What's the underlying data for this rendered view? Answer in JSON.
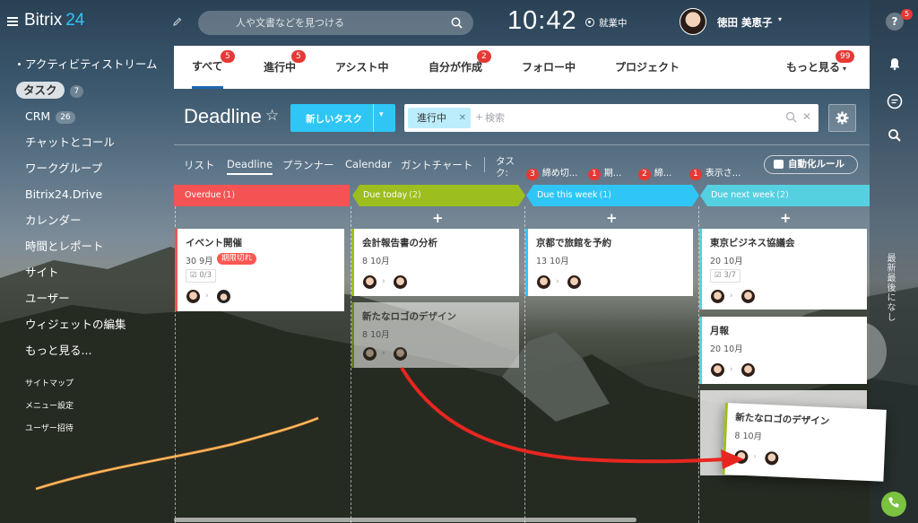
{
  "app": {
    "brand": "Bitrix",
    "brand_version": "24"
  },
  "left_menu": {
    "items": [
      {
        "label": "アクティビティストリーム",
        "counter": ""
      },
      {
        "label": "タスク",
        "counter": "7",
        "active": true
      },
      {
        "label": "CRM",
        "counter": "26"
      },
      {
        "label": "チャットとコール",
        "counter": ""
      },
      {
        "label": "ワークグループ",
        "counter": ""
      },
      {
        "label": "Bitrix24.Drive",
        "counter": ""
      },
      {
        "label": "カレンダー",
        "counter": ""
      },
      {
        "label": "時間とレポート",
        "counter": ""
      },
      {
        "label": "サイト",
        "counter": ""
      },
      {
        "label": "ユーザー",
        "counter": ""
      },
      {
        "label": "ウィジェットの編集",
        "counter": ""
      },
      {
        "label": "もっと見る...",
        "counter": ""
      }
    ],
    "sitemap": "サイトマップ",
    "menu_settings": "メニュー設定",
    "invite_users": "ユーザー招待"
  },
  "header": {
    "search_placeholder": "人や文書などを見つける",
    "clock": "10:42",
    "work_status": "就業中",
    "user_name": "徳田 美恵子"
  },
  "right_bar": {
    "help_badge": "5",
    "vertical_text": "最新最後になし"
  },
  "tabs": [
    {
      "label": "すべて",
      "badge": "5",
      "active": true
    },
    {
      "label": "進行中",
      "badge": "5"
    },
    {
      "label": "アシスト中",
      "badge": ""
    },
    {
      "label": "自分が作成",
      "badge": "2"
    },
    {
      "label": "フォロー中",
      "badge": ""
    },
    {
      "label": "プロジェクト",
      "badge": ""
    },
    {
      "label": "もっと見る",
      "badge": "99"
    }
  ],
  "toolbar": {
    "page_title": "Deadline",
    "new_task_label": "新しいタスク",
    "filter_chip": "進行中",
    "filter_placeholder": "検索"
  },
  "views": {
    "items": [
      "リスト",
      "Deadline",
      "プランナー",
      "Calendar",
      "ガントチャート"
    ],
    "active": "Deadline",
    "tasks_label": "タスク:",
    "counters": [
      {
        "count": "3",
        "label": "締め切..."
      },
      {
        "count": "1",
        "label": "期..."
      },
      {
        "count": "2",
        "label": "締..."
      },
      {
        "count": "1",
        "label": "表示さ..."
      }
    ],
    "automation_label": "自動化ルール"
  },
  "columns": [
    {
      "title": "Overdue",
      "count": "(1)",
      "color": "#f55353"
    },
    {
      "title": "Due today",
      "count": "(2)",
      "color": "#9cbe1e"
    },
    {
      "title": "Due this week",
      "count": "(1)",
      "color": "#2fc6f6"
    },
    {
      "title": "Due next week",
      "count": "(2)",
      "color": "#55d0e0"
    }
  ],
  "cards": {
    "overdue_1": {
      "title": "イベント開催",
      "date": "30 9月",
      "badge": "期限切れ",
      "checklist": "0/3"
    },
    "today_1": {
      "title": "会計報告書の分析",
      "date": "8 10月"
    },
    "today_2": {
      "title": "新たなロゴのデザイン",
      "date": "8 10月"
    },
    "week_1": {
      "title": "京都で旅館を予約",
      "date": "13 10月"
    },
    "next_1": {
      "title": "東京ビジネス協議会",
      "date": "20 10月",
      "checklist": "3/7"
    },
    "next_2": {
      "title": "月報",
      "date": "20 10月"
    },
    "dragged": {
      "title": "新たなロゴのデザイン",
      "date": "8 10月"
    }
  }
}
